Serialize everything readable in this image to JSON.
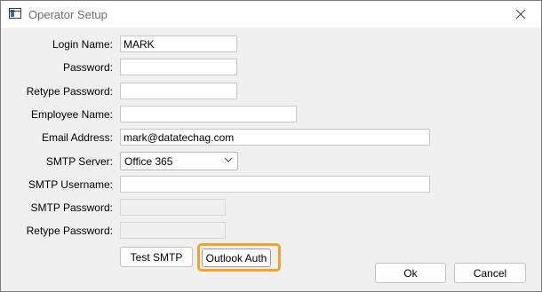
{
  "window": {
    "title": "Operator Setup"
  },
  "fields": {
    "login_name": {
      "label": "Login Name:",
      "value": "MARK"
    },
    "password": {
      "label": "Password:",
      "value": ""
    },
    "retype_password": {
      "label": "Retype Password:",
      "value": ""
    },
    "employee_name": {
      "label": "Employee Name:",
      "value": ""
    },
    "email": {
      "label": "Email Address:",
      "value": "mark@datatechag.com"
    },
    "smtp_server": {
      "label": "SMTP Server:",
      "value": "Office 365"
    },
    "smtp_username": {
      "label": "SMTP Username:",
      "value": ""
    },
    "smtp_password": {
      "label": "SMTP Password:",
      "value": ""
    },
    "smtp_retype_password": {
      "label": "Retype Password:",
      "value": ""
    }
  },
  "buttons": {
    "test_smtp": "Test SMTP",
    "outlook_auth": "Outlook Auth",
    "ok": "Ok",
    "cancel": "Cancel"
  },
  "icons": {
    "app": "window-icon",
    "close": "close-icon",
    "dropdown": "chevron-down-icon"
  },
  "colors": {
    "focus_highlight": "#f0a42c"
  }
}
